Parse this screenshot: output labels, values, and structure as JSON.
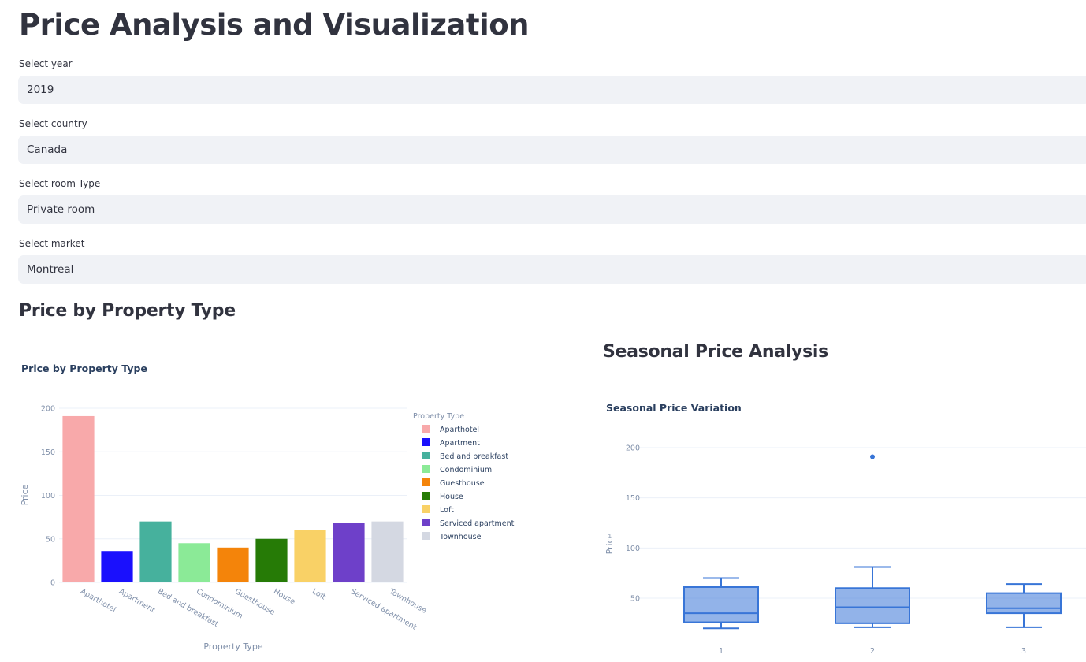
{
  "page": {
    "title": "Price Analysis and Visualization"
  },
  "filters": [
    {
      "label": "Select year",
      "value": "2019"
    },
    {
      "label": "Select country",
      "value": "Canada"
    },
    {
      "label": "Select room Type",
      "value": "Private room"
    },
    {
      "label": "Select market",
      "value": "Montreal"
    }
  ],
  "sections": {
    "property": {
      "heading": "Price by Property Type"
    },
    "seasonal": {
      "heading": "Seasonal Price Analysis"
    }
  },
  "chart_data": [
    {
      "type": "bar",
      "title": "Price by Property Type",
      "xlabel": "Property Type",
      "ylabel": "Price",
      "ylim": [
        0,
        200
      ],
      "yticks": [
        0,
        50,
        100,
        150,
        200
      ],
      "grid": true,
      "legend": {
        "title": "Property Type",
        "placement": "right"
      },
      "categories": [
        "Aparthotel",
        "Apartment",
        "Bed and breakfast",
        "Condominium",
        "Guesthouse",
        "House",
        "Loft",
        "Serviced apartment",
        "Townhouse"
      ],
      "values": [
        191,
        36,
        70,
        45,
        40,
        50,
        60,
        68,
        70
      ],
      "colors": [
        "#f8a9aa",
        "#1a10fd",
        "#46b19d",
        "#8bea97",
        "#f4840a",
        "#267b06",
        "#f9d166",
        "#6e40c9",
        "#d4d8e2"
      ]
    },
    {
      "type": "box",
      "title": "Seasonal Price Variation",
      "ylabel": "Price",
      "xlabel": "",
      "categories": [
        "1",
        "2",
        "3"
      ],
      "yticks": [
        50,
        100,
        150,
        200
      ],
      "grid": true,
      "color": "#3875d7",
      "boxes": [
        {
          "x": "1",
          "min": 20,
          "q1": 26,
          "median": 35,
          "q3": 61,
          "max": 70,
          "outliers": []
        },
        {
          "x": "2",
          "min": 21,
          "q1": 25,
          "median": 41,
          "q3": 60,
          "max": 81,
          "outliers": [
            191
          ]
        },
        {
          "x": "3",
          "min": 21,
          "q1": 35,
          "median": 40,
          "q3": 55,
          "max": 64,
          "outliers": []
        }
      ]
    }
  ]
}
